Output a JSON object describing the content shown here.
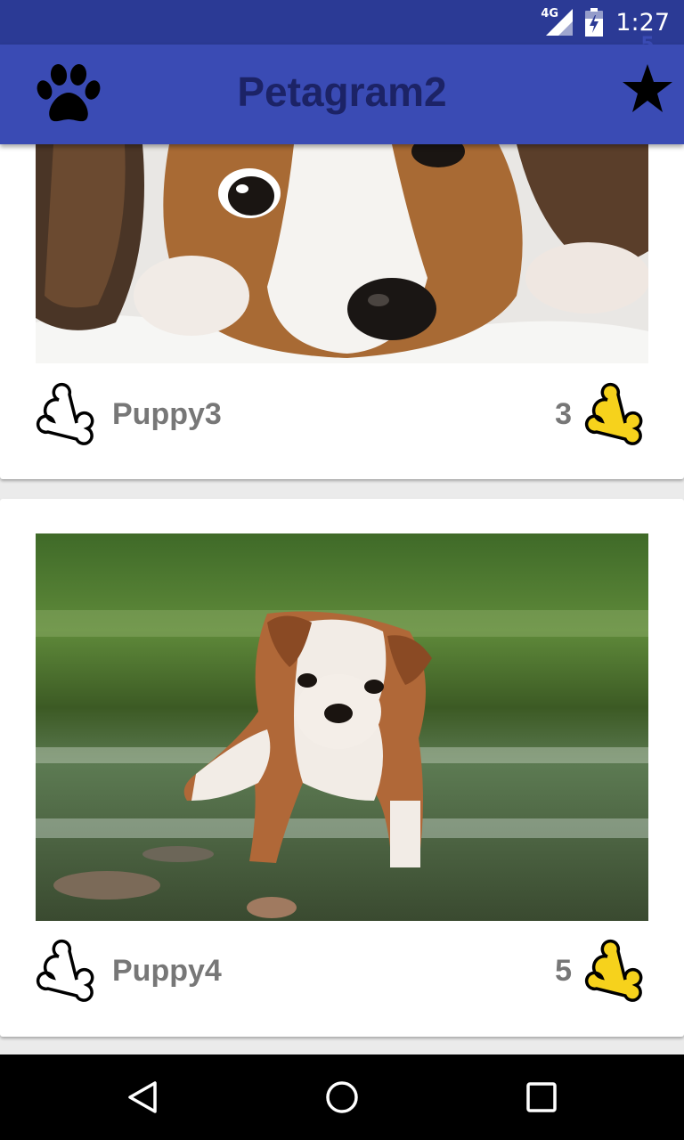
{
  "status_bar": {
    "network": "4G",
    "time": "1:27",
    "icons": [
      "signal-icon",
      "battery-icon"
    ]
  },
  "app_bar": {
    "title": "Petagram2",
    "left_icon": "paw-icon",
    "right_icon": "star-icon",
    "favorites_count": "5"
  },
  "pets": [
    {
      "name": "Puppy3",
      "likes": "3",
      "photo": "beagle puppy lying on white fluffy rug",
      "like_icon": "bone-outline-icon",
      "count_icon": "bone-filled-icon"
    },
    {
      "name": "Puppy4",
      "likes": "5",
      "photo": "bulldog puppy standing in water",
      "like_icon": "bone-outline-icon",
      "count_icon": "bone-filled-icon"
    }
  ],
  "nav_bar": {
    "buttons": [
      "back-icon",
      "home-icon",
      "recents-icon"
    ]
  },
  "colors": {
    "status_bar": "#2b3a95",
    "app_bar": "#3a4bb4",
    "title": "#1c2366",
    "bone_yellow": "#f6d21c",
    "label_gray": "#777777"
  }
}
